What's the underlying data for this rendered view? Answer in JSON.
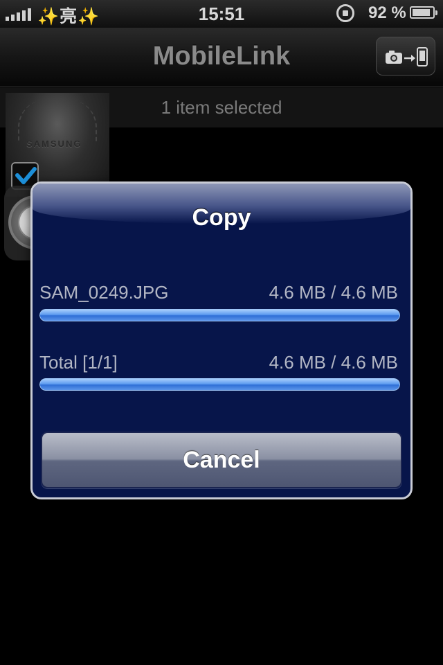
{
  "status_bar": {
    "carrier": "✨亮✨",
    "time": "15:51",
    "battery_percent": "92 %",
    "battery_level": 0.92,
    "signal_icon": "signal-bars-icon",
    "rotation_icon": "rotation-lock-icon",
    "battery_icon": "battery-icon"
  },
  "nav": {
    "title": "MobileLink",
    "camera_button_icon": "camera-to-phone-icon"
  },
  "selection": {
    "text": "1 item selected"
  },
  "thumbnail": {
    "logo_text": "SAMSUNG",
    "checked": true
  },
  "dialog": {
    "title": "Copy",
    "file": {
      "name": "SAM_0249.JPG",
      "size": "4.6 MB / 4.6 MB",
      "progress": 1.0
    },
    "total": {
      "label": "Total [1/1]",
      "size": "4.6 MB / 4.6 MB",
      "progress": 1.0
    },
    "cancel_label": "Cancel"
  },
  "colors": {
    "dialog_background": "#07154a",
    "progress_fill": "#4f8ff0",
    "checkbox_check": "#1d8fd8"
  }
}
